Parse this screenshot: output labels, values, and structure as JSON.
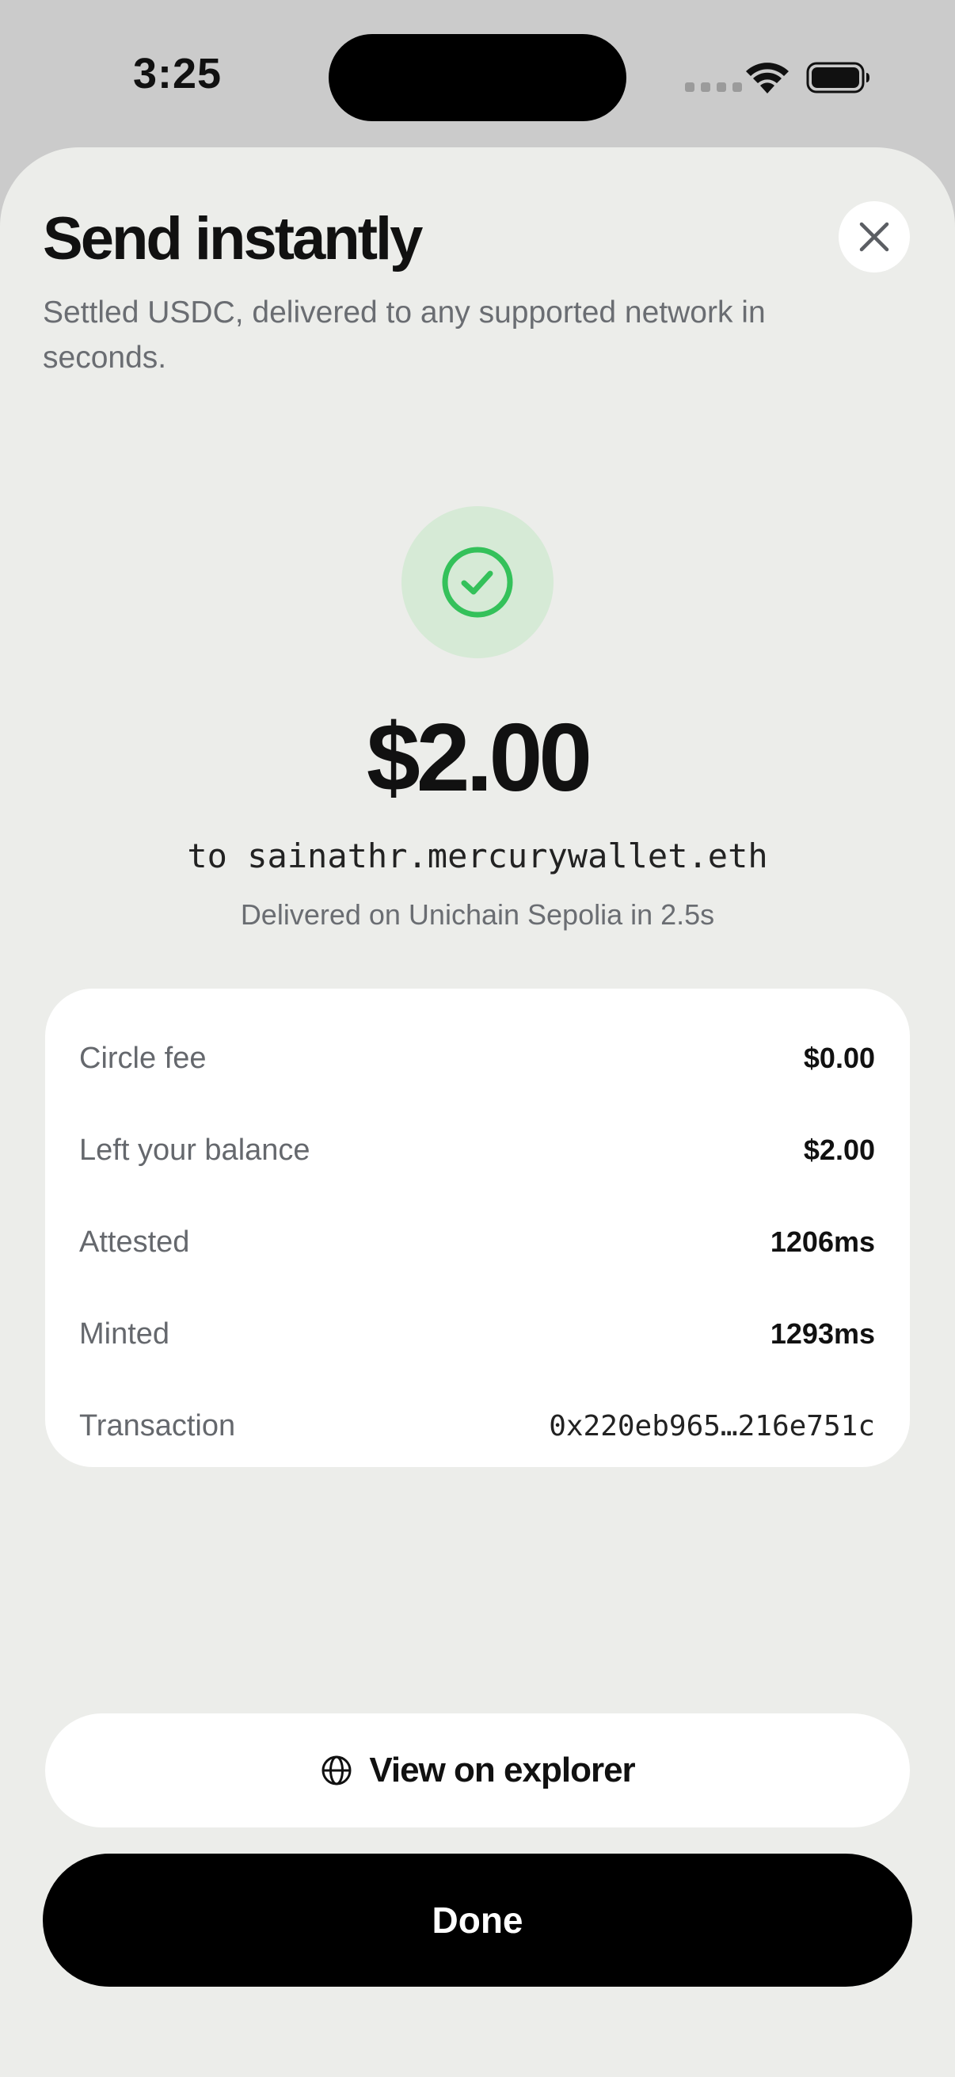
{
  "status_bar": {
    "time": "3:25"
  },
  "header": {
    "title": "Send instantly",
    "subtitle": "Settled USDC, delivered to any supported network in seconds."
  },
  "receipt": {
    "amount": "$2.00",
    "recipient": "to sainathr.mercurywallet.eth",
    "delivery_note": "Delivered on Unichain Sepolia in 2.5s"
  },
  "details": [
    {
      "label": "Circle fee",
      "value": "$0.00"
    },
    {
      "label": "Left your balance",
      "value": "$2.00"
    },
    {
      "label": "Attested",
      "value": "1206ms"
    },
    {
      "label": "Minted",
      "value": "1293ms"
    },
    {
      "label": "Transaction",
      "value": "0x220eb965…216e751c"
    }
  ],
  "actions": {
    "explorer_label": "View on explorer",
    "done_label": "Done"
  },
  "icons": {
    "close": "close-icon",
    "success": "check-circle-icon",
    "explorer": "globe-icon"
  },
  "colors": {
    "sheet_background": "#ecedea",
    "success_green": "#34c15a",
    "success_badge_bg": "#d6ead6",
    "primary_button": "#000000"
  }
}
